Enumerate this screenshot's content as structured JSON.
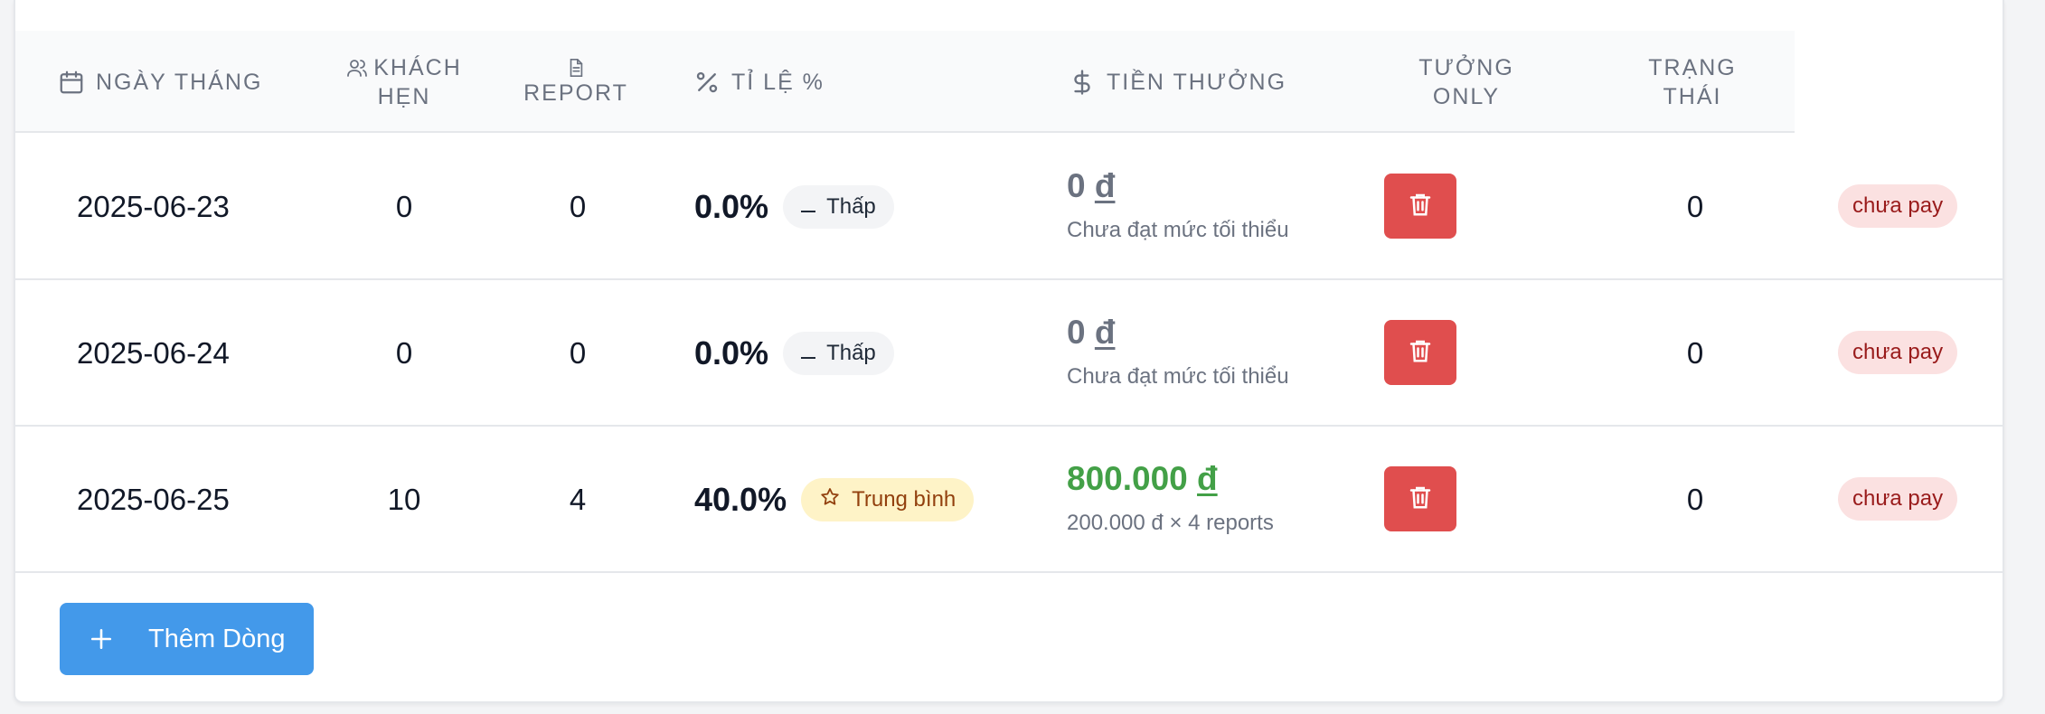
{
  "headers": {
    "date": "Ngày tháng",
    "customers_line1": "Khách",
    "customers_line2": "hẹn",
    "report": "Report",
    "rate": "Tỉ lệ %",
    "bonus": "Tiền thưởng",
    "tuong_only_line1": "Tưởng",
    "tuong_only_line2": "only",
    "status_line1": "Trạng",
    "status_line2": "thái"
  },
  "rows": [
    {
      "date": "2025-06-23",
      "customers": "0",
      "reports": "0",
      "rate": "0.0%",
      "rate_level": "Thấp",
      "rate_level_icon": "dash-icon",
      "bonus_amount": "0",
      "currency": "đ",
      "bonus_note": "Chưa đạt mức tối thiểu",
      "tuong_only": "0",
      "status": "chưa pay"
    },
    {
      "date": "2025-06-24",
      "customers": "0",
      "reports": "0",
      "rate": "0.0%",
      "rate_level": "Thấp",
      "rate_level_icon": "dash-icon",
      "bonus_amount": "0",
      "currency": "đ",
      "bonus_note": "Chưa đạt mức tối thiểu",
      "tuong_only": "0",
      "status": "chưa pay"
    },
    {
      "date": "2025-06-25",
      "customers": "10",
      "reports": "4",
      "rate": "40.0%",
      "rate_level": "Trung bình",
      "rate_level_icon": "star-icon",
      "bonus_amount": "800.000",
      "currency": "đ",
      "bonus_note": "200.000 đ × 4 reports",
      "tuong_only": "0",
      "status": "chưa pay"
    }
  ],
  "add_button": {
    "label": "Thêm Dòng",
    "icon": "plus-icon"
  },
  "colors": {
    "delete_button": "#e04e4e",
    "bonus_positive": "#43a047",
    "status_badge_bg": "#fbe1e1",
    "status_badge_text": "#991b1b",
    "add_button": "#4399ea",
    "badge_low_bg": "#f3f4f6",
    "badge_mid_bg": "#fef3c7"
  }
}
